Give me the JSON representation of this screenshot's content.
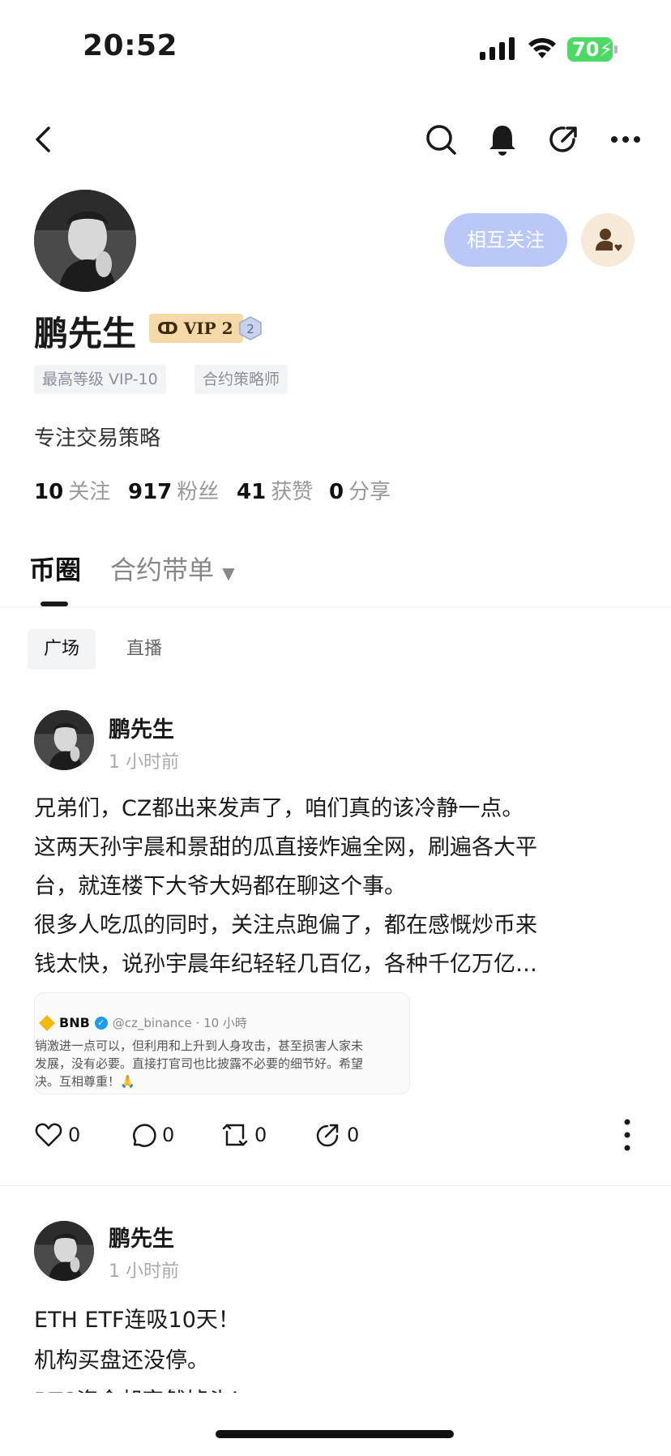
{
  "status_bar": {
    "time": "20:52",
    "battery": "70"
  },
  "header": {
    "icons": [
      "back-icon",
      "search-icon",
      "bell-icon",
      "share-icon",
      "more-icon"
    ]
  },
  "profile": {
    "name": "鹏先生",
    "vip_badge": "VIP 2",
    "level_badge": "2",
    "follow_button": "相互关注",
    "tags": [
      "最高等级 VIP-10",
      "合约策略师"
    ],
    "bio": "专注交易策略",
    "stats": [
      {
        "value": "10",
        "label": "关注"
      },
      {
        "value": "917",
        "label": "粉丝"
      },
      {
        "value": "41",
        "label": "获赞"
      },
      {
        "value": "0",
        "label": "分享"
      }
    ]
  },
  "tabs": {
    "main": [
      "币圈",
      "合约带单"
    ],
    "sub": [
      "广场",
      "直播"
    ]
  },
  "posts": [
    {
      "author": "鹏先生",
      "time": "1 小时前",
      "lines": [
        "兄弟们，CZ都出来发声了，咱们真的该冷静一点。",
        "这两天孙宇晨和景甜的瓜直接炸遍全网，刷遍各大平",
        "台，就连楼下大爷大妈都在聊这个事。",
        "很多人吃瓜的同时，关注点跑偏了，都在感慨炒币来",
        "钱太快，说孙宇晨年纪轻轻几百亿，各种千亿万亿…"
      ],
      "embed": {
        "name": "BNB",
        "handle": "@cz_binance · 10 小時",
        "lines": [
          "销激进一点可以，但利用和上升到人身攻击，甚至损害人家未",
          "发展，没有必要。直接打官司也比披露不必要的细节好。希望",
          "决。互相尊重！🙏"
        ]
      },
      "actions": {
        "likes": "0",
        "comments": "0",
        "reposts": "0",
        "shares": "0"
      }
    },
    {
      "author": "鹏先生",
      "time": "1 小时前",
      "lines": [
        "ETH ETF连吸10天！",
        "机构买盘还没停。",
        "BTC资金却突然掉头！"
      ]
    }
  ]
}
